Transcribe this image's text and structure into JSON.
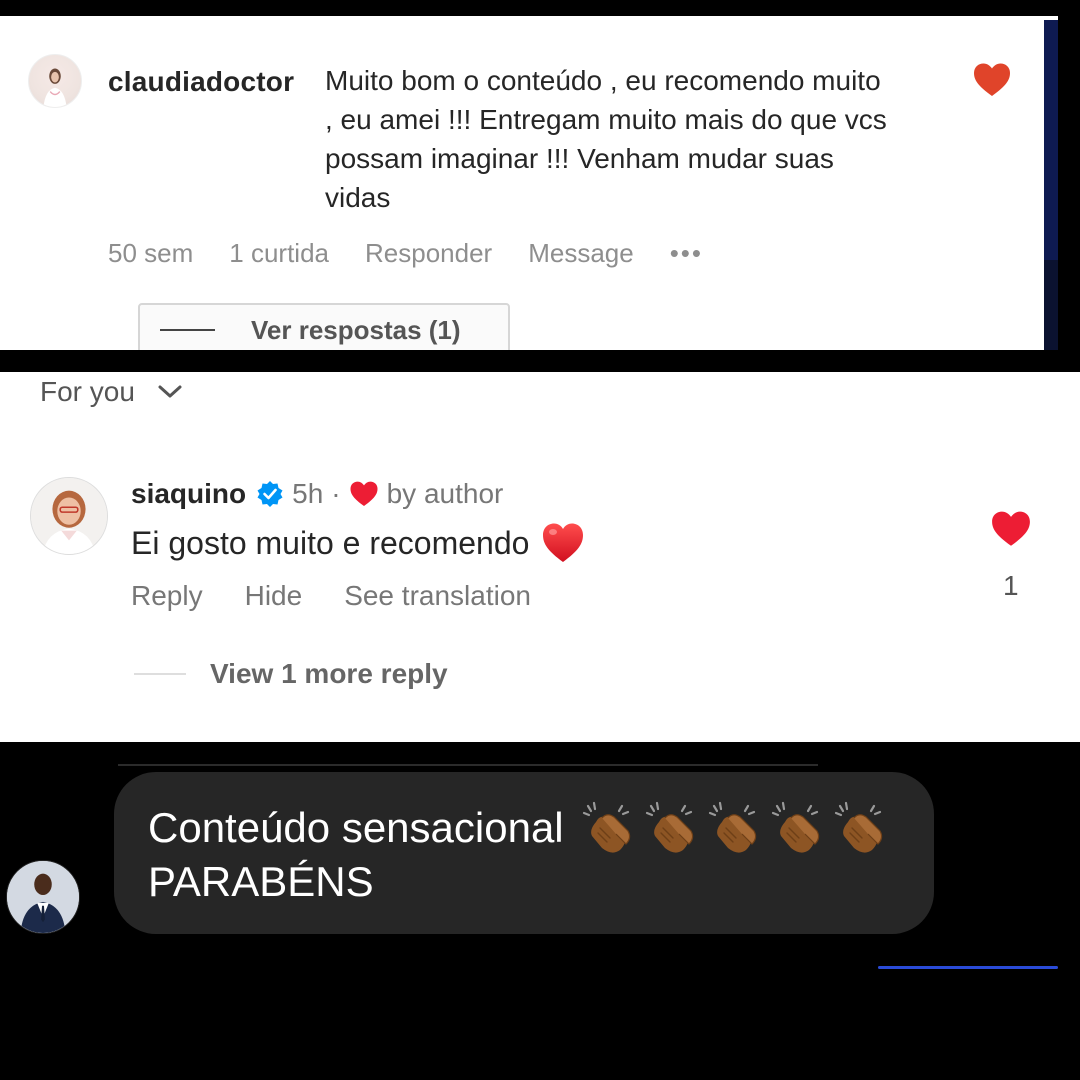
{
  "comment_desktop": {
    "username": "claudiadoctor",
    "text": "Muito bom o conteúdo , eu recomendo muito\n, eu amei !!! Entregam muito mais do que vcs\npossam imaginar !!! Venham mudar suas\nvidas",
    "time": "50 sem",
    "likes": "1 curtida",
    "reply_label": "Responder",
    "message_label": "Message",
    "more_label": "•••",
    "view_replies_label": "Ver respostas (1)",
    "heart_color": "#e0442a"
  },
  "comment_mobile": {
    "sort_label": "For you",
    "username": "siaquino",
    "time": "5h",
    "separator": "·",
    "liked_by_author_label": "by author",
    "text": "Ei gosto muito e recomendo",
    "actions": [
      "Reply",
      "Hide",
      "See translation"
    ],
    "like_count": "1",
    "view_more_label": "View 1 more reply",
    "heart_color": "#ed1d34",
    "verified_color": "#0095f6"
  },
  "comment_dark": {
    "line1": "Conteúdo sensacional",
    "line2": "PARABÉNS",
    "clap_count": 5,
    "bubble_color": "#262626"
  }
}
